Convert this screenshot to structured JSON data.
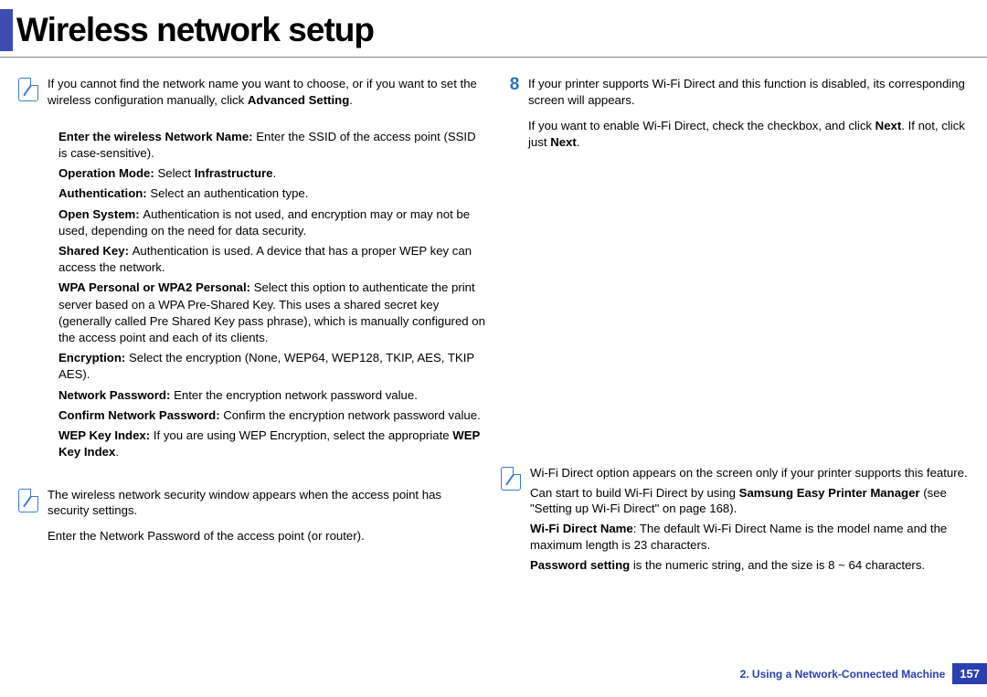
{
  "title": "Wireless network setup",
  "left": {
    "note1_main": "If you cannot find the network name you want to choose, or if you want to set the wireless configuration manually, click ",
    "note1_bold": "Advanced Setting",
    "note1_tail": ".",
    "li1_pre": "Enter the wireless Network Name: ",
    "li1_post": "Enter the SSID of the access point (SSID is case-sensitive).",
    "li2_pre": "Operation Mode: ",
    "li2_mid": "Select ",
    "li2_bold2": "Infrastructure",
    "li2_tail": ".",
    "li3_pre": "Authentication: ",
    "li3_post": "Select an authentication type.",
    "li4_pre": "Open System: ",
    "li4_post": "Authentication is not used, and encryption may or may not be used, depending on the need for data security.",
    "li5_pre": "Shared Key: ",
    "li5_post": "Authentication is used. A device that has a proper WEP key can access the network.",
    "li6_pre": "WPA Personal or WPA2 Personal: ",
    "li6_post": "Select this option to authenticate the print server based on a WPA Pre-Shared Key. This uses a shared secret key (generally called Pre Shared Key pass phrase), which is manually configured on the access point and each of its clients.",
    "li7_pre": "Encryption: ",
    "li7_post": "Select the encryption (None, WEP64, WEP128, TKIP, AES, TKIP AES).",
    "li8_pre": "Network Password: ",
    "li8_post": "Enter the encryption network password value.",
    "li9_pre": "Confirm Network Password: ",
    "li9_post": "Confirm the encryption network password value.",
    "li10_pre": "WEP Key Index: ",
    "li10_mid": "If you are using WEP Encryption, select the appropriate ",
    "li10_bold2": "WEP Key Index",
    "li10_tail": ".",
    "note2": "The wireless network security window appears when the access point has security settings.",
    "note2_sub": "Enter the Network Password of the access point (or router)."
  },
  "right": {
    "step_num": "8",
    "step_p1a": "If your printer supports Wi-Fi Direct and this function is disabled, its corresponding screen will appears.",
    "step_p2a": "If you want to enable Wi-Fi Direct, check the checkbox, and click ",
    "step_p2b": "Next",
    "step_p2c": ". If not, click just ",
    "step_p2d": "Next",
    "step_p2e": ".",
    "note_r1": "Wi-Fi Direct option appears on the screen only if your printer supports this feature.",
    "note_r2a": "Can start to build Wi-Fi Direct by using ",
    "note_r2b": "Samsung Easy Printer Manager",
    "note_r2c": " (see \"Setting up Wi-Fi Direct\" on page 168).",
    "note_r3a": "Wi-Fi Direct Name",
    "note_r3b": ": The default Wi-Fi Direct Name is the model name and the maximum length is 23 characters.",
    "note_r4a": "Password setting",
    "note_r4b": " is the numeric string, and the size is 8 ~ 64 characters."
  },
  "footer": {
    "chapter": "2.  Using a Network-Connected Machine",
    "page": "157"
  }
}
